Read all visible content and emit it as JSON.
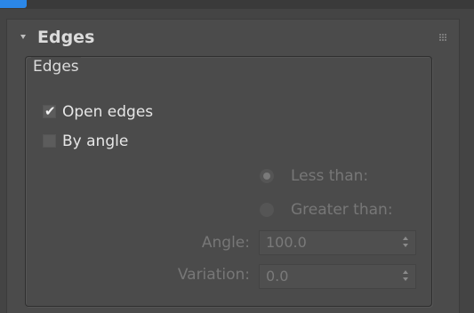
{
  "colors": {
    "background": "#444444",
    "panel": "#4b4b4b",
    "accent": "#2b87e8",
    "text_enabled": "#e6e6e6",
    "text_disabled": "#777777"
  },
  "rollout": {
    "title": "Edges",
    "collapse_icon": "triangle-down-icon",
    "grip_icon": "drag-grip-icon",
    "expanded": true
  },
  "group": {
    "label": "Edges"
  },
  "options": {
    "open_edges": {
      "label": "Open edges",
      "checked": true
    },
    "by_angle": {
      "label": "By angle",
      "checked": false
    }
  },
  "angle_mode": {
    "enabled": false,
    "less_than": {
      "label": "Less than:",
      "selected": true
    },
    "greater_than": {
      "label": "Greater than:",
      "selected": false
    }
  },
  "fields": {
    "angle": {
      "label": "Angle:",
      "value": "100.0",
      "enabled": false
    },
    "variation": {
      "label": "Variation:",
      "value": "0.0",
      "enabled": false
    }
  }
}
